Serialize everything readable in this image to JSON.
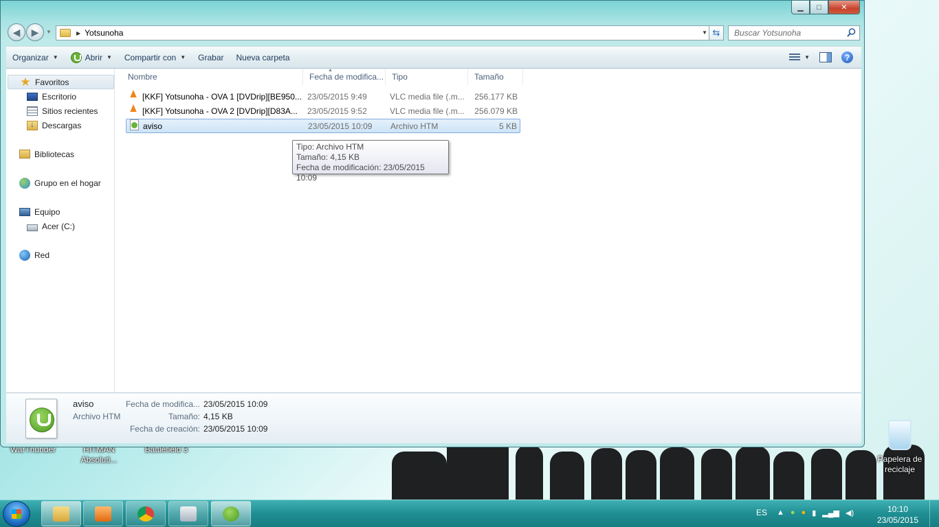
{
  "window": {
    "address_path": "Yotsunoha",
    "search_placeholder": "Buscar Yotsunoha",
    "minimize": "▁",
    "maximize": "□",
    "close": "✕"
  },
  "toolbar": {
    "organize": "Organizar",
    "open": "Abrir",
    "share": "Compartir con",
    "burn": "Grabar",
    "new_folder": "Nueva carpeta"
  },
  "nav": {
    "favorites": "Favoritos",
    "desktop": "Escritorio",
    "recent": "Sitios recientes",
    "downloads": "Descargas",
    "libraries": "Bibliotecas",
    "homegroup": "Grupo en el hogar",
    "computer": "Equipo",
    "drive": "Acer (C:)",
    "network": "Red"
  },
  "columns": {
    "name": "Nombre",
    "date": "Fecha de modifica...",
    "type": "Tipo",
    "size": "Tamaño"
  },
  "files": [
    {
      "name": "[KKF] Yotsunoha - OVA 1 [DVDrip][BE950...",
      "date": "23/05/2015 9:49",
      "type": "VLC media file (.m...",
      "size": "256.177 KB",
      "icon": "vlc-icon"
    },
    {
      "name": "[KKF] Yotsunoha - OVA 2 [DVDrip][D83A...",
      "date": "23/05/2015 9:52",
      "type": "VLC media file (.m...",
      "size": "256.079 KB",
      "icon": "vlc-icon"
    },
    {
      "name": "aviso",
      "date": "23/05/2015 10:09",
      "type": "Archivo HTM",
      "size": "5 KB",
      "icon": "utorrent-file-icon"
    }
  ],
  "tooltip": {
    "line1": "Tipo: Archivo HTM",
    "line2": "Tamaño: 4,15 KB",
    "line3": "Fecha de modificación: 23/05/2015 10:09"
  },
  "details": {
    "name": "aviso",
    "type": "Archivo HTM",
    "modified_label": "Fecha de modifica...",
    "modified_value": "23/05/2015 10:09",
    "size_label": "Tamaño:",
    "size_value": "4,15 KB",
    "created_label": "Fecha de creación:",
    "created_value": "23/05/2015 10:09"
  },
  "desktop": {
    "icon1": "WarThunder",
    "icon2_l1": "HITMAN",
    "icon2_l2": "Absoluti...",
    "icon3": "Battlefield 3",
    "recycle_l1": "Papelera de",
    "recycle_l2": "reciclaje"
  },
  "taskbar": {
    "lang": "ES",
    "time": "10:10",
    "date": "23/05/2015"
  },
  "colors": {
    "accent": "#1f8f93",
    "selection": "#cde4f7"
  }
}
